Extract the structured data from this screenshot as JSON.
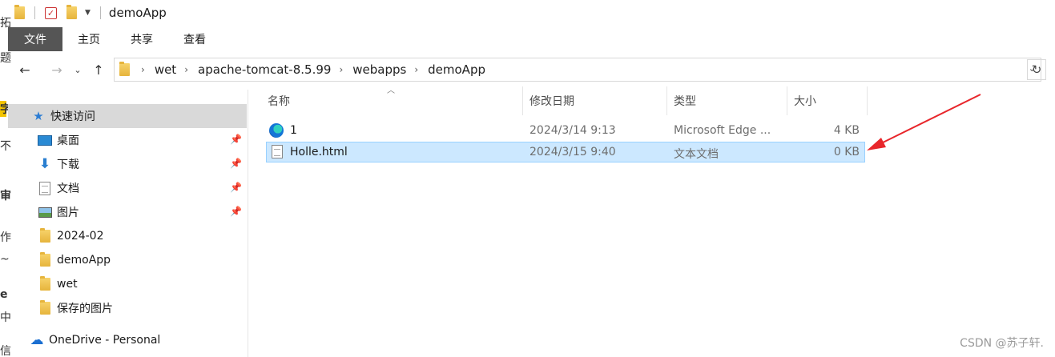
{
  "window": {
    "title": "demoApp"
  },
  "background_text": [
    "拓",
    "题",
    "字",
    "不",
    "审",
    "作",
    "~",
    "e",
    "中",
    "信"
  ],
  "ribbon": {
    "tabs": [
      "文件",
      "主页",
      "共享",
      "查看"
    ]
  },
  "address": {
    "breadcrumbs": [
      "wet",
      "apache-tomcat-8.5.99",
      "webapps",
      "demoApp"
    ]
  },
  "sidebar": {
    "quick_access": "快速访问",
    "items": [
      {
        "label": "桌面",
        "icon": "desktop-icon",
        "pinned": true
      },
      {
        "label": "下载",
        "icon": "download-icon",
        "pinned": true
      },
      {
        "label": "文档",
        "icon": "document-icon",
        "pinned": true
      },
      {
        "label": "图片",
        "icon": "picture-icon",
        "pinned": true
      },
      {
        "label": "2024-02",
        "icon": "folder-icon",
        "pinned": false
      },
      {
        "label": "demoApp",
        "icon": "folder-icon",
        "pinned": false
      },
      {
        "label": "wet",
        "icon": "folder-icon",
        "pinned": false
      },
      {
        "label": "保存的图片",
        "icon": "folder-icon",
        "pinned": false
      }
    ],
    "onedrive": "OneDrive - Personal"
  },
  "columns": {
    "name": "名称",
    "modified": "修改日期",
    "type": "类型",
    "size": "大小"
  },
  "files": [
    {
      "name": "1",
      "modified": "2024/3/14 9:13",
      "type": "Microsoft Edge ...",
      "size": "4 KB",
      "icon": "edge-icon",
      "selected": false
    },
    {
      "name": "Holle.html",
      "modified": "2024/3/15 9:40",
      "type": "文本文档",
      "size": "0 KB",
      "icon": "text-file-icon",
      "selected": true
    }
  ],
  "watermark": "CSDN @苏子轩.",
  "colors": {
    "selection": "#cce8ff",
    "file_tab": "#555555",
    "annotation_arrow": "#e8262b"
  }
}
